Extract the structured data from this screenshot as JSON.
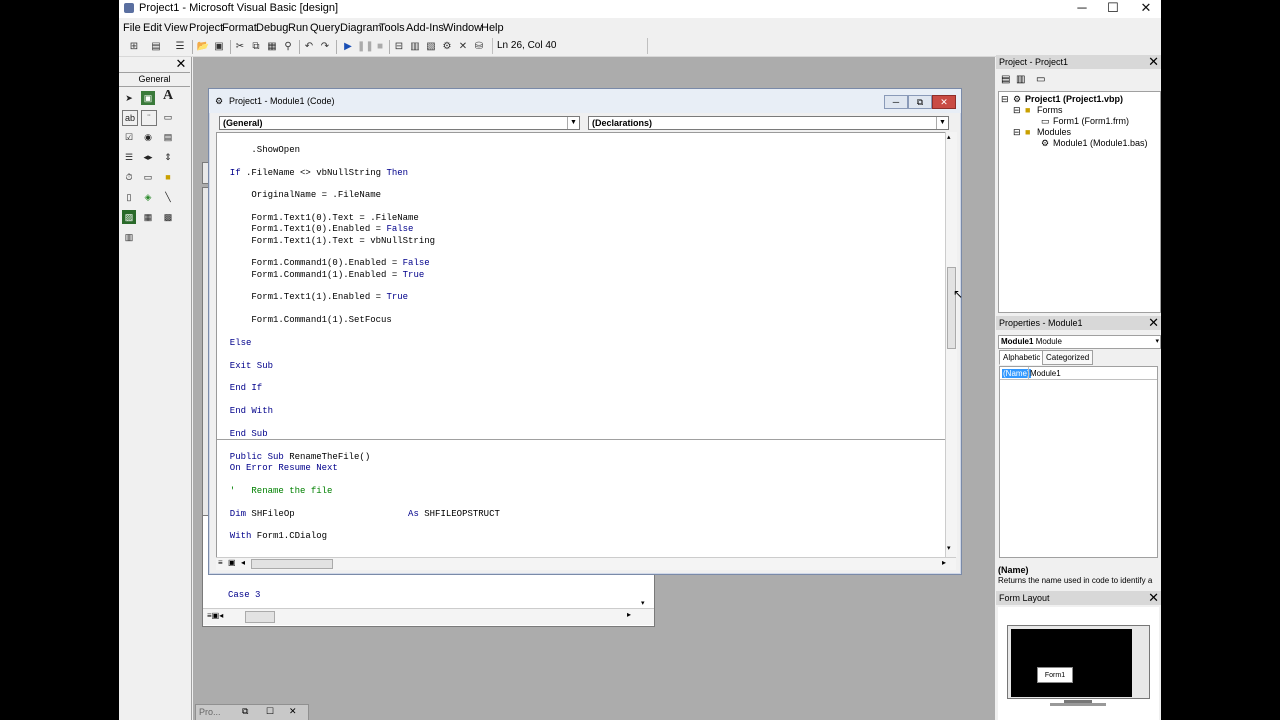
{
  "window": {
    "title": "Project1 - Microsoft Visual Basic [design]",
    "minimize": "─",
    "maximize": "☐",
    "close": "✕"
  },
  "menu": [
    "File",
    "Edit",
    "View",
    "Project",
    "Format",
    "Debug",
    "Run",
    "Query",
    "Diagram",
    "Tools",
    "Add-Ins",
    "Window",
    "Help"
  ],
  "toolbar": {
    "position": "Ln 26, Col 40"
  },
  "toolbox": {
    "tab": "General",
    "close": "✕",
    "label_tool": "A"
  },
  "code_window": {
    "title": "Project1 - Module1 (Code)",
    "object_combo": "(General)",
    "proc_combo": "(Declarations)",
    "lines": [
      {
        "t": "      .ShowOpen"
      },
      {
        "t": "  If .FileName <> vbNullString Then"
      },
      {
        "t": "      OriginalName = .FileName"
      },
      {
        "t": "      Form1.Text1(0).Text = .FileName"
      },
      {
        "t": "      Form1.Text1(0).Enabled = False"
      },
      {
        "t": "      Form1.Text1(1).Text = vbNullString"
      },
      {
        "t": "      Form1.Command1(0).Enabled = False"
      },
      {
        "t": "      Form1.Command1(1).Enabled = True"
      },
      {
        "t": "      Form1.Text1(1).Enabled = True"
      },
      {
        "t": "      Form1.Command1(1).SetFocus"
      },
      {
        "t": "  Else"
      },
      {
        "t": "  Exit Sub"
      },
      {
        "t": "  End If"
      },
      {
        "t": "  End With"
      },
      {
        "t": "  End Sub"
      },
      {
        "t": "  Public Sub RenameTheFile()"
      },
      {
        "t": "  On Error Resume Next"
      },
      {
        "t": "  '   Rename the file"
      },
      {
        "t": "  Dim SHFileOp                     As SHFILEOPSTRUCT"
      },
      {
        "t": "  With Form1.CDialog"
      }
    ]
  },
  "background_code": {
    "line": "Case 3"
  },
  "project_panel": {
    "title": "Project - Project1",
    "close": "✕",
    "root": "Project1 (Project1.vbp)",
    "forms_folder": "Forms",
    "form_item": "Form1 (Form1.frm)",
    "modules_folder": "Modules",
    "module_item": "Module1 (Module1.bas)"
  },
  "properties_panel": {
    "title": "Properties - Module1",
    "close": "✕",
    "object_name": "Module1",
    "object_type": "Module",
    "tab_alpha": "Alphabetic",
    "tab_cat": "Categorized",
    "prop_name": "(Name)",
    "prop_value": "Module1",
    "desc_title": "(Name)",
    "desc_text": "Returns the name used in code to identify a"
  },
  "form_layout": {
    "title": "Form Layout",
    "close": "✕",
    "form_label": "Form1"
  },
  "taskbar": {
    "label": "Pro..."
  }
}
